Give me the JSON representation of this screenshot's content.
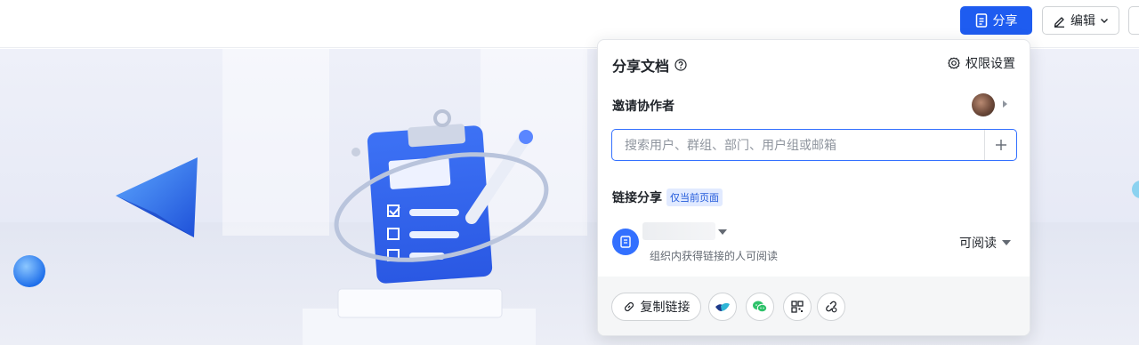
{
  "toolbar": {
    "share_label": "分享",
    "edit_label": "编辑"
  },
  "share_panel": {
    "title": "分享文档",
    "help_icon": "question-circle-icon",
    "permission_settings_label": "权限设置",
    "invite_label": "邀请协作者",
    "search_placeholder": "搜索用户、群组、部门、用户组或邮箱",
    "link_share_label": "链接分享",
    "page_badge": "仅当前页面",
    "link_scope_description": "组织内获得链接的人可阅读",
    "link_permission": "可阅读",
    "copy_link_label": "复制链接",
    "share_targets": [
      "lark-icon",
      "wechat-icon",
      "qrcode-icon",
      "link-settings-icon"
    ]
  },
  "colors": {
    "primary": "#1e5cf0",
    "accent_blue": "#3370ff",
    "badge_bg": "#e1eaff"
  }
}
